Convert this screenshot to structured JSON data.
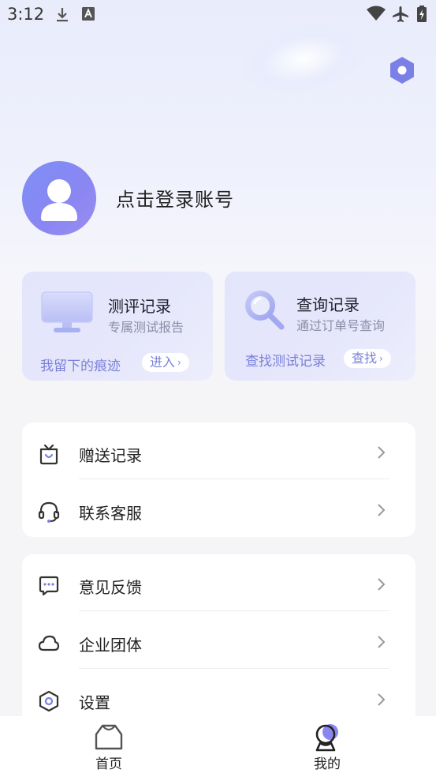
{
  "status_bar": {
    "time": "3:12"
  },
  "profile": {
    "login_prompt": "点击登录账号"
  },
  "cards": {
    "evaluation": {
      "title": "测评记录",
      "subtitle": "专属测试报告",
      "link_text": "我留下的痕迹",
      "button_label": "进入"
    },
    "query": {
      "title": "查询记录",
      "subtitle": "通过订单号查询",
      "link_text": "查找测试记录",
      "button_label": "查找"
    }
  },
  "menu_group_1": [
    {
      "label": "赠送记录",
      "icon": "gift-icon"
    },
    {
      "label": "联系客服",
      "icon": "headset-icon"
    }
  ],
  "menu_group_2": [
    {
      "label": "意见反馈",
      "icon": "chat-bubble-icon"
    },
    {
      "label": "企业团体",
      "icon": "cloud-icon"
    },
    {
      "label": "设置",
      "icon": "hexagon-settings-icon"
    }
  ],
  "bottom_nav": [
    {
      "label": "首页",
      "icon": "home-icon",
      "active": false
    },
    {
      "label": "我的",
      "icon": "profile-icon",
      "active": true
    }
  ],
  "colors": {
    "accent": "#7b80d8",
    "avatar": "#8a8cf2",
    "card_bg": "#e4e6fb"
  }
}
